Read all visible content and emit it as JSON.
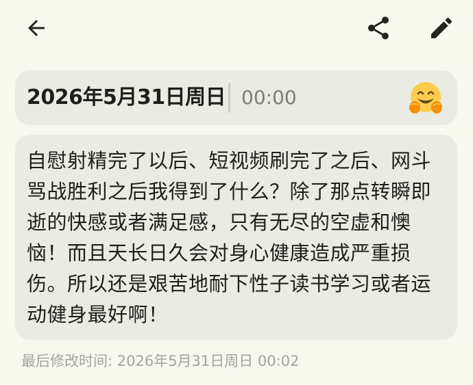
{
  "toolbar": {
    "back_icon": "arrow-left-icon",
    "share_icon": "share-icon",
    "edit_icon": "pencil-icon"
  },
  "entry": {
    "date": "2026年5月31日周日",
    "time": "00:00",
    "mood_icon": "hugging-face-icon",
    "content": "自慰射精完了以后、短视频刷完了之后、网斗骂战胜利之后我得到了什么？除了那点转瞬即逝的快感或者满足感，只有无尽的空虚和懊恼！而且天长日久会对身心健康造成严重损伤。所以还是艰苦地耐下性子读书学习或者运动健身最好啊！",
    "last_modified": "最后修改时间: 2026年5月31日周日 00:02"
  },
  "colors": {
    "background": "#f7f9ef",
    "card": "#eaece4",
    "text": "#1d1f1b",
    "muted": "#7b7d77",
    "icon": "#24261f"
  }
}
